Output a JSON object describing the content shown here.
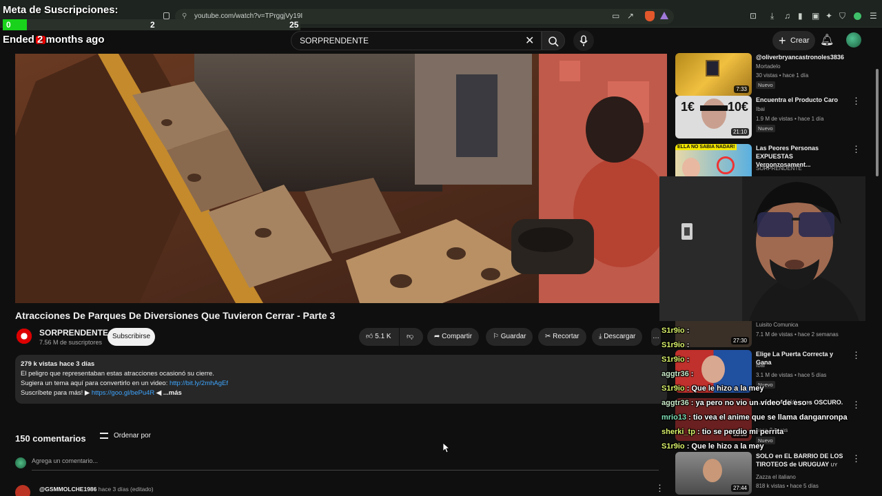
{
  "browser": {
    "url": "youtube.com/watch?v=TPrggjVy19I"
  },
  "overlay": {
    "goal_title": "Meta de Suscripciones:",
    "goal_current": "0",
    "goal_mid": "2",
    "goal_target": "25",
    "goal_progress": 0.08,
    "ended_text": "Ended 2 months ago"
  },
  "header": {
    "search_value": "SORPRENDENTE",
    "create_label": "Crear"
  },
  "video": {
    "title": "Atracciones De Parques De Diversiones Que Tuvieron Cerrar - Parte 3",
    "channel": "SORPRENDENTE",
    "subscribers": "7.56 M de suscriptores",
    "subscribe_label": "Subscribirse",
    "likes": "5.1 K",
    "share_label": "Compartir",
    "save_label": "Guardar",
    "clip_label": "Recortar",
    "download_label": "Descargar"
  },
  "description": {
    "stats": "279 k vistas  hace 3 días",
    "line1": "El peligro que representaban estas atracciones ocasionó su cierre.",
    "line2_text": "Sugiera un tema aquí para convertirlo en un video: ",
    "line2_link": "http://bit.ly/2mhAgEf",
    "line3_text": "Suscríbete para más! ▶ ",
    "line3_link": "https://goo.gl/bePu4R",
    "more": " ◀ ...más"
  },
  "comments": {
    "count": "150 comentarios",
    "sort_label": "Ordenar por",
    "add_placeholder": "Agrega un comentario...",
    "first_author": "@GSMMOLCHE1986",
    "first_meta": " hace 3 días (editado)"
  },
  "recommendations": [
    {
      "title": "@oliverbryancastronoles3836",
      "channel": "Mortadelo",
      "meta": "30 vistas • hace 1 día",
      "badge": "Nuevo",
      "duration": "7:33"
    },
    {
      "title": "Encuentra el Producto Caro",
      "channel": "Ibai",
      "meta": "1.9 M de vistas • hace 1 día",
      "badge": "Nuevo",
      "duration": "21:10",
      "thumb_text_left": "1€",
      "thumb_text_right": "10€"
    },
    {
      "title": "Las Peores Personas EXPUESTAS Vergonzosament...",
      "channel": "SORPRENDENTE",
      "meta": "",
      "badge": "",
      "duration": "",
      "thumb_text": "ELLA NO SABIA NADAR!"
    },
    {
      "title": "",
      "channel": "Luisito Comunica",
      "meta": "7.1 M de vistas • hace 2 semanas",
      "badge": "",
      "duration": "27:30"
    },
    {
      "title": "Elige La Puerta Correcta y Gana",
      "channel": "Ibai",
      "meta": "3.1 M de vistas • hace 5 días",
      "badge": "Nuevo",
      "duration": ""
    },
    {
      "title": "...armet Asiático es OSCURO.",
      "channel": "",
      "meta": "hace 2 horas",
      "badge": "Nuevo",
      "duration": "33:33"
    },
    {
      "title": "SOLO en EL BARRIO DE LOS TIROTEOS de URUGUAY",
      "channel": "Zazza el italiano",
      "meta": "818 k vistas • hace 5 días",
      "badge": "",
      "duration": "27:44",
      "title_suffix": "UY"
    }
  ],
  "chat": [
    {
      "user": "S1r9io",
      "msg": " : "
    },
    {
      "user": "S1r9io",
      "msg": " : "
    },
    {
      "user": "S1r9io",
      "msg": " : "
    },
    {
      "user": "aggtr36",
      "msg": " : "
    },
    {
      "user": "S1r9io",
      "msg": " : Que le hizo a la mey"
    },
    {
      "user": "aggtr36",
      "msg": " : ya pero no vio un vídeo de eso"
    },
    {
      "user": "mrio13",
      "msg": " : tio vea el anime que se llama danganronpa"
    },
    {
      "user": "sherki_tp",
      "msg": " : tio se perdio mi perrita"
    },
    {
      "user": "S1r9io",
      "msg": " : Que le hizo a la mey"
    }
  ],
  "colors": {
    "chat_user_1": "#d9f26a",
    "chat_user_2": "#c8e8c8",
    "chat_user_3": "#7fe0b8",
    "link": "#3ea6ff",
    "goal_fill": "#19d21b"
  }
}
